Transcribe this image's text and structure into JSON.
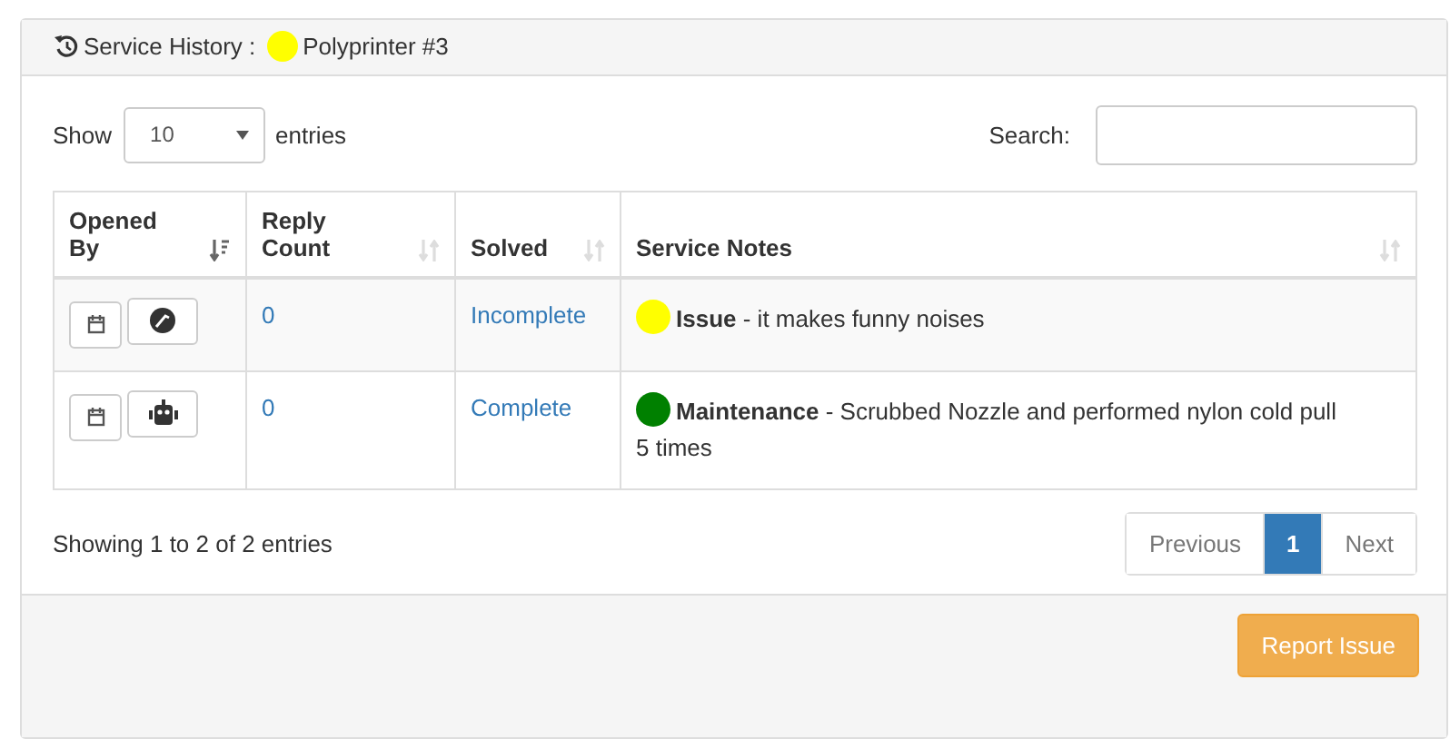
{
  "panel": {
    "title": "Service History :",
    "printer": {
      "color": "#ffff00",
      "name": "Polyprinter #3"
    }
  },
  "length": {
    "show_label": "Show",
    "value": "10",
    "entries_label": "entries"
  },
  "search": {
    "label": "Search:"
  },
  "table": {
    "columns": [
      {
        "label": "Opened By",
        "sorted": true
      },
      {
        "label": "Reply Count",
        "sorted": false
      },
      {
        "label": "Solved",
        "sorted": false
      },
      {
        "label": "Service Notes",
        "sorted": false
      }
    ],
    "rows": [
      {
        "kind": "user",
        "reply_count": "0",
        "solved": "Incomplete",
        "note": {
          "color": "#ffff00",
          "type": "Issue",
          "text": " - it makes funny noises"
        }
      },
      {
        "kind": "robot",
        "reply_count": "0",
        "solved": "Complete",
        "note": {
          "color": "#008000",
          "type": "Maintenance",
          "text": " - Scrubbed Nozzle and performed nylon cold pull 5 times"
        }
      }
    ]
  },
  "info": "Showing 1 to 2 of 2 entries",
  "pagination": {
    "previous": "Previous",
    "pages": [
      {
        "label": "1",
        "selected": true
      }
    ],
    "next": "Next"
  },
  "footer": {
    "button": "Report Issue"
  }
}
